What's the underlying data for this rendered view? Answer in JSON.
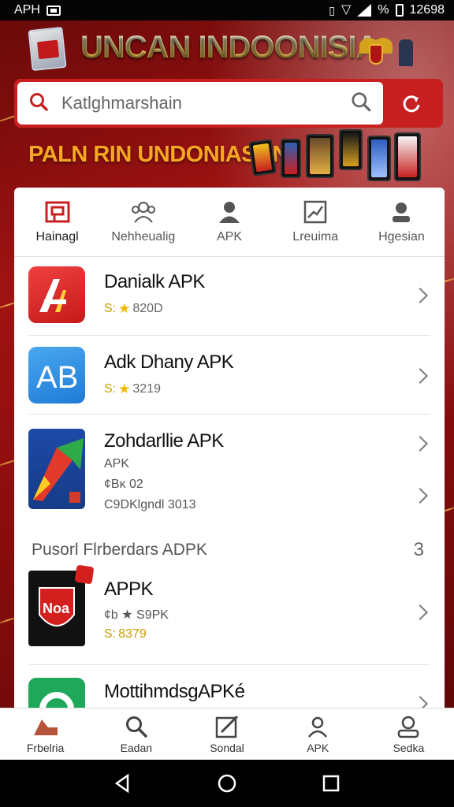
{
  "status_bar": {
    "left_text": "APH",
    "right_text": "%",
    "time": "12698"
  },
  "header": {
    "title": "UNCAN INDOONISIA"
  },
  "search": {
    "placeholder": "Katlghmarshain"
  },
  "promo": {
    "text": "PALN RIN UNDONIASAN"
  },
  "tabs": [
    {
      "label": "Hainagl",
      "icon": "store-icon"
    },
    {
      "label": "Nehheualig",
      "icon": "people-icon"
    },
    {
      "label": "APK",
      "icon": "person-icon"
    },
    {
      "label": "Lreuima",
      "icon": "chart-icon"
    },
    {
      "label": "Hgesian",
      "icon": "user-icon"
    }
  ],
  "apps": [
    {
      "title": "Danialk APK",
      "rating_prefix": "S:",
      "rating_value": "820D",
      "color": "#d92b2b"
    },
    {
      "title": "Adk Dhany APK",
      "rating_prefix": "S:",
      "rating_value": "3219",
      "color": "#2f8fe0"
    },
    {
      "title": "Zohdarllie APK",
      "subtitle": "APK",
      "line1": "¢Bĸ 02",
      "line2": "C9DKlgndl 3013"
    }
  ],
  "section": {
    "title": "Pusorl Flrberdars ADPK",
    "number": "3"
  },
  "section_apps": [
    {
      "title": "APPK",
      "badge": "Noa",
      "sub": "¢b ★ S9PK",
      "rating_prefix": "S:",
      "rating_value": "8379"
    },
    {
      "title": "MottihmdsgAPKé"
    }
  ],
  "bottom_nav": [
    {
      "label": "Frbelria",
      "icon": "shield-icon"
    },
    {
      "label": "Eadan",
      "icon": "search-icon"
    },
    {
      "label": "Sondal",
      "icon": "edit-icon"
    },
    {
      "label": "APK",
      "icon": "user-icon"
    },
    {
      "label": "Sedka",
      "icon": "profile-icon"
    }
  ]
}
